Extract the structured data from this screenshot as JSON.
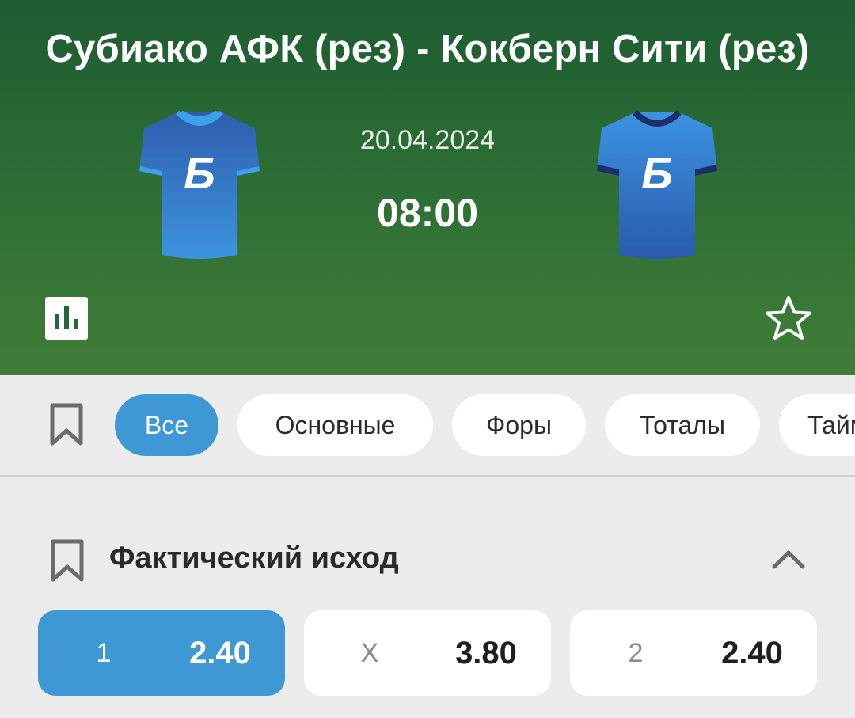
{
  "match": {
    "title": "Субиако АФК (рез) - Кокберн Сити (рез)",
    "date": "20.04.2024",
    "time": "08:00",
    "home_kit_icon": "jersey-icon",
    "away_kit_icon": "jersey-icon",
    "kit_letter": "Б"
  },
  "actions": {
    "stats_icon": "bar-chart-icon",
    "favorite_icon": "star-outline-icon"
  },
  "filters": {
    "bookmark_icon": "bookmark-icon",
    "chips": [
      "Все",
      "Основные",
      "Форы",
      "Тоталы",
      "Тайм"
    ],
    "active_index": 0
  },
  "market": {
    "title": "Фактический исход",
    "collapse_icon": "chevron-up-icon",
    "odds": [
      {
        "label": "1",
        "value": "2.40",
        "selected": true
      },
      {
        "label": "X",
        "value": "3.80",
        "selected": false
      },
      {
        "label": "2",
        "value": "2.40",
        "selected": false
      }
    ]
  },
  "colors": {
    "header_top": "#1d5c31",
    "header_bottom": "#3f7d37",
    "accent": "#3e98d3",
    "background": "#ececed"
  }
}
